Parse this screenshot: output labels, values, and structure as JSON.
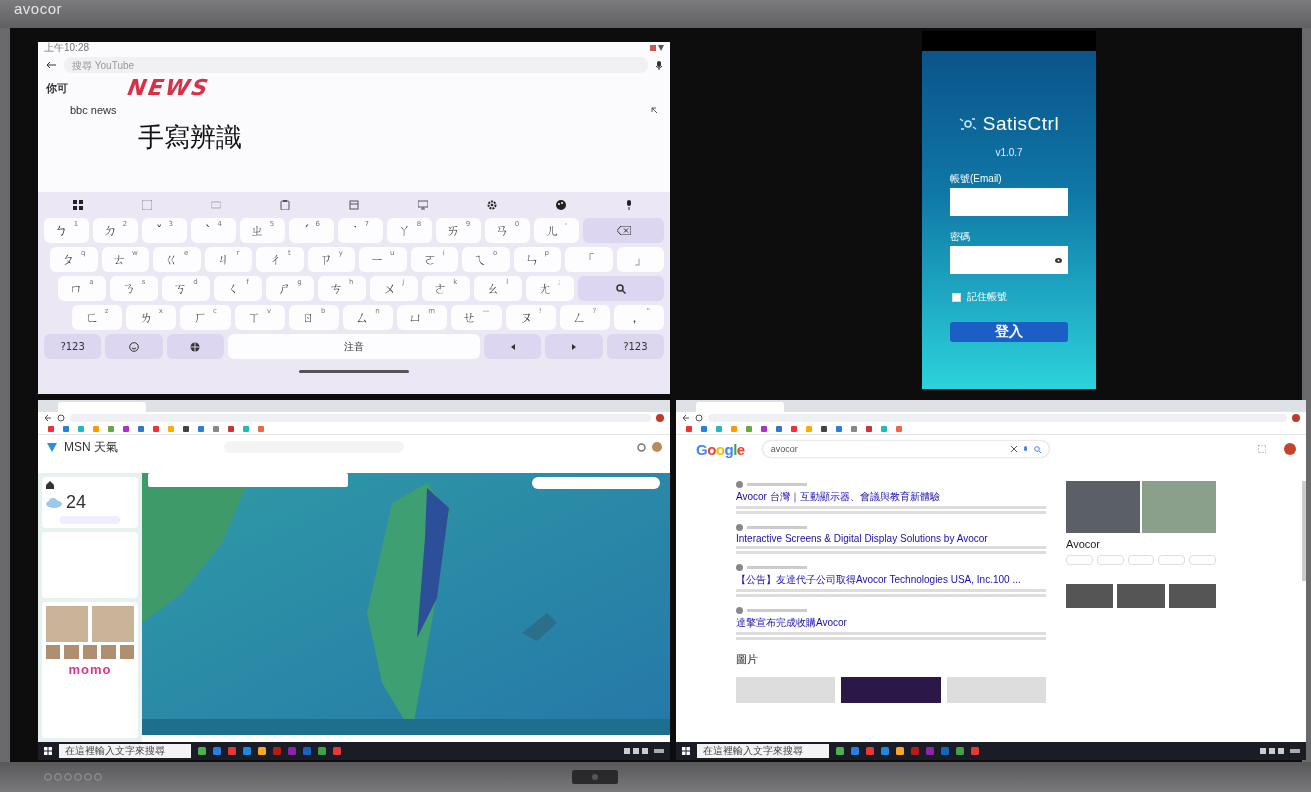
{
  "bezel": {
    "brand": "avocor"
  },
  "keyboard_panel": {
    "status_time": "上午10:28",
    "search_placeholder": "搜尋 YouTube",
    "handwriting": "NEWS",
    "candidate": "你可",
    "suggestion": "bbc news",
    "caption": "手寫辨識",
    "key_rows": [
      [
        {
          "kind": "char",
          "label": "ㄅ",
          "hint": "1"
        },
        {
          "kind": "char",
          "label": "ㄉ",
          "hint": "2"
        },
        {
          "kind": "char",
          "label": "ˇ",
          "hint": "3"
        },
        {
          "kind": "char",
          "label": "ˋ",
          "hint": "4"
        },
        {
          "kind": "char",
          "label": "ㄓ",
          "hint": "5"
        },
        {
          "kind": "char",
          "label": "ˊ",
          "hint": "6"
        },
        {
          "kind": "char",
          "label": "˙",
          "hint": "7"
        },
        {
          "kind": "char",
          "label": "ㄚ",
          "hint": "8"
        },
        {
          "kind": "char",
          "label": "ㄞ",
          "hint": "9"
        },
        {
          "kind": "char",
          "label": "ㄢ",
          "hint": "0"
        },
        {
          "kind": "char",
          "label": "ㄦ",
          "hint": "-"
        },
        {
          "kind": "backspace"
        }
      ],
      [
        {
          "kind": "char",
          "label": "ㄆ",
          "hint": "q"
        },
        {
          "kind": "char",
          "label": "ㄊ",
          "hint": "w"
        },
        {
          "kind": "char",
          "label": "ㄍ",
          "hint": "e"
        },
        {
          "kind": "char",
          "label": "ㄐ",
          "hint": "r"
        },
        {
          "kind": "char",
          "label": "ㄔ",
          "hint": "t"
        },
        {
          "kind": "char",
          "label": "ㄗ",
          "hint": "y"
        },
        {
          "kind": "char",
          "label": "ㄧ",
          "hint": "u"
        },
        {
          "kind": "char",
          "label": "ㄛ",
          "hint": "i"
        },
        {
          "kind": "char",
          "label": "ㄟ",
          "hint": "o"
        },
        {
          "kind": "char",
          "label": "ㄣ",
          "hint": "p"
        },
        {
          "kind": "char",
          "label": "「"
        },
        {
          "kind": "char",
          "label": "」"
        }
      ],
      [
        {
          "kind": "char",
          "label": "ㄇ",
          "hint": "a"
        },
        {
          "kind": "char",
          "label": "ㄋ",
          "hint": "s"
        },
        {
          "kind": "char",
          "label": "ㄎ",
          "hint": "d"
        },
        {
          "kind": "char",
          "label": "ㄑ",
          "hint": "f"
        },
        {
          "kind": "char",
          "label": "ㄕ",
          "hint": "g"
        },
        {
          "kind": "char",
          "label": "ㄘ",
          "hint": "h"
        },
        {
          "kind": "char",
          "label": "ㄨ",
          "hint": "j"
        },
        {
          "kind": "char",
          "label": "ㄜ",
          "hint": "k"
        },
        {
          "kind": "char",
          "label": "ㄠ",
          "hint": "l"
        },
        {
          "kind": "char",
          "label": "ㄤ",
          "hint": ";"
        },
        {
          "kind": "search"
        }
      ],
      [
        {
          "kind": "char",
          "label": "ㄈ",
          "hint": "z"
        },
        {
          "kind": "char",
          "label": "ㄌ",
          "hint": "x"
        },
        {
          "kind": "char",
          "label": "ㄏ",
          "hint": "c"
        },
        {
          "kind": "char",
          "label": "ㄒ",
          "hint": "v"
        },
        {
          "kind": "char",
          "label": "ㄖ",
          "hint": "b"
        },
        {
          "kind": "char",
          "label": "ㄙ",
          "hint": "n"
        },
        {
          "kind": "char",
          "label": "ㄩ",
          "hint": "m"
        },
        {
          "kind": "char",
          "label": "ㄝ",
          "hint": "—"
        },
        {
          "kind": "char",
          "label": "ㄡ",
          "hint": "!"
        },
        {
          "kind": "char",
          "label": "ㄥ",
          "hint": "?"
        },
        {
          "kind": "char",
          "label": "，",
          "hint": "\""
        }
      ]
    ],
    "bottom_keys": [
      {
        "kind": "text",
        "label": "?123"
      },
      {
        "kind": "emoji"
      },
      {
        "kind": "globe"
      },
      {
        "kind": "space",
        "label": "注音"
      },
      {
        "kind": "left"
      },
      {
        "kind": "right"
      },
      {
        "kind": "text",
        "label": "?123"
      }
    ]
  },
  "phone": {
    "app_name": "SatisCtrl",
    "version": "v1.0.7",
    "email_label": "帳號(Email)",
    "password_label": "密碼",
    "remember": {
      "label": "記住帳號",
      "checked": false
    },
    "login_button": "登入"
  },
  "weather_window": {
    "brand": "MSN 天氣",
    "temperature": "24",
    "ad_brand": "momo",
    "taskbar_search": "在這裡輸入文字來搜尋"
  },
  "search_window": {
    "logo": "Google",
    "query": "avocor",
    "results": [
      {
        "title": "Avocor 台灣｜互動顯示器、會議與教育新體驗"
      },
      {
        "title": "Interactive Screens & Digital Display Solutions by Avocor"
      },
      {
        "title": "【公告】友達代子公司取得Avocor Technologies USA, Inc.100 ..."
      },
      {
        "title": "達擎宣布完成收購Avocor"
      }
    ],
    "images_heading": "圖片",
    "panel_title": "Avocor",
    "taskbar_search": "在這裡輸入文字來搜尋"
  }
}
